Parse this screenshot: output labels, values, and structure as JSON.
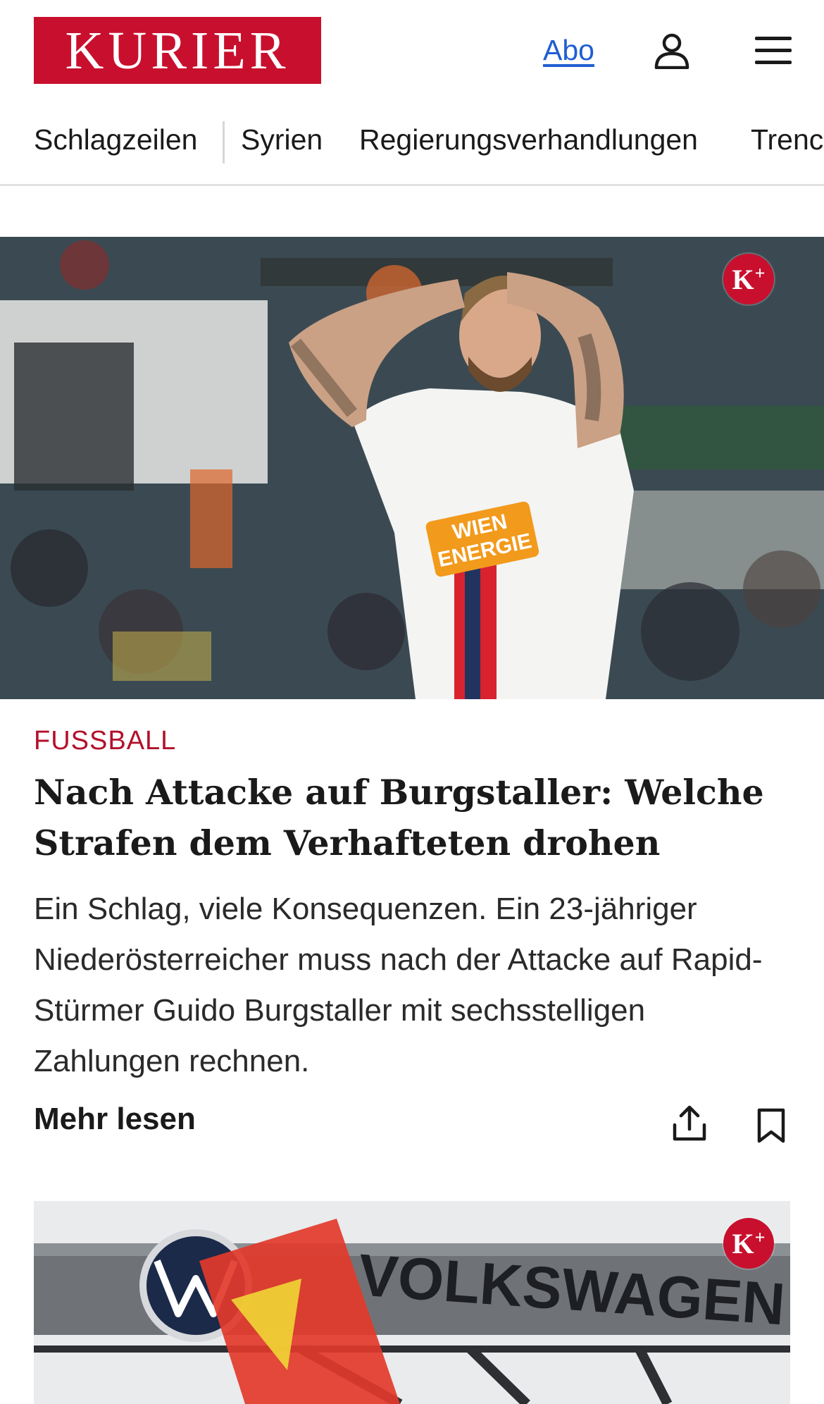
{
  "header": {
    "logo_text": "KURIER",
    "abo_label": "Abo",
    "brand_color": "#c8102e",
    "user_icon": "user-icon",
    "menu_icon": "hamburger-menu-icon"
  },
  "nav": {
    "items": [
      {
        "label": "Schlagzeilen"
      },
      {
        "label": "Syrien"
      },
      {
        "label": "Regierungsverhandlungen"
      },
      {
        "label": "Trenc"
      }
    ]
  },
  "articles": [
    {
      "image_alt_icon": "photo-football-player",
      "premium_badge": "K",
      "premium_plus": "+",
      "category": "FUSSBALL",
      "headline": "Nach Attacke auf Burgstaller: Welche Strafen dem Verhafteten drohen",
      "teaser": "Ein Schlag, viele Konsequenzen. Ein 23-jähriger Niederösterreicher muss nach der Attacke auf Rapid-Stürmer Guido Burgstaller mit sechsstelligen Zahlungen rechnen.",
      "more_label": "Mehr lesen",
      "share_icon": "share-icon",
      "bookmark_icon": "bookmark-icon"
    },
    {
      "image_alt_icon": "photo-volkswagen-sign",
      "premium_badge": "K",
      "premium_plus": "+"
    }
  ],
  "colors": {
    "category": "#b3102a",
    "link": "#1f5fd1"
  }
}
